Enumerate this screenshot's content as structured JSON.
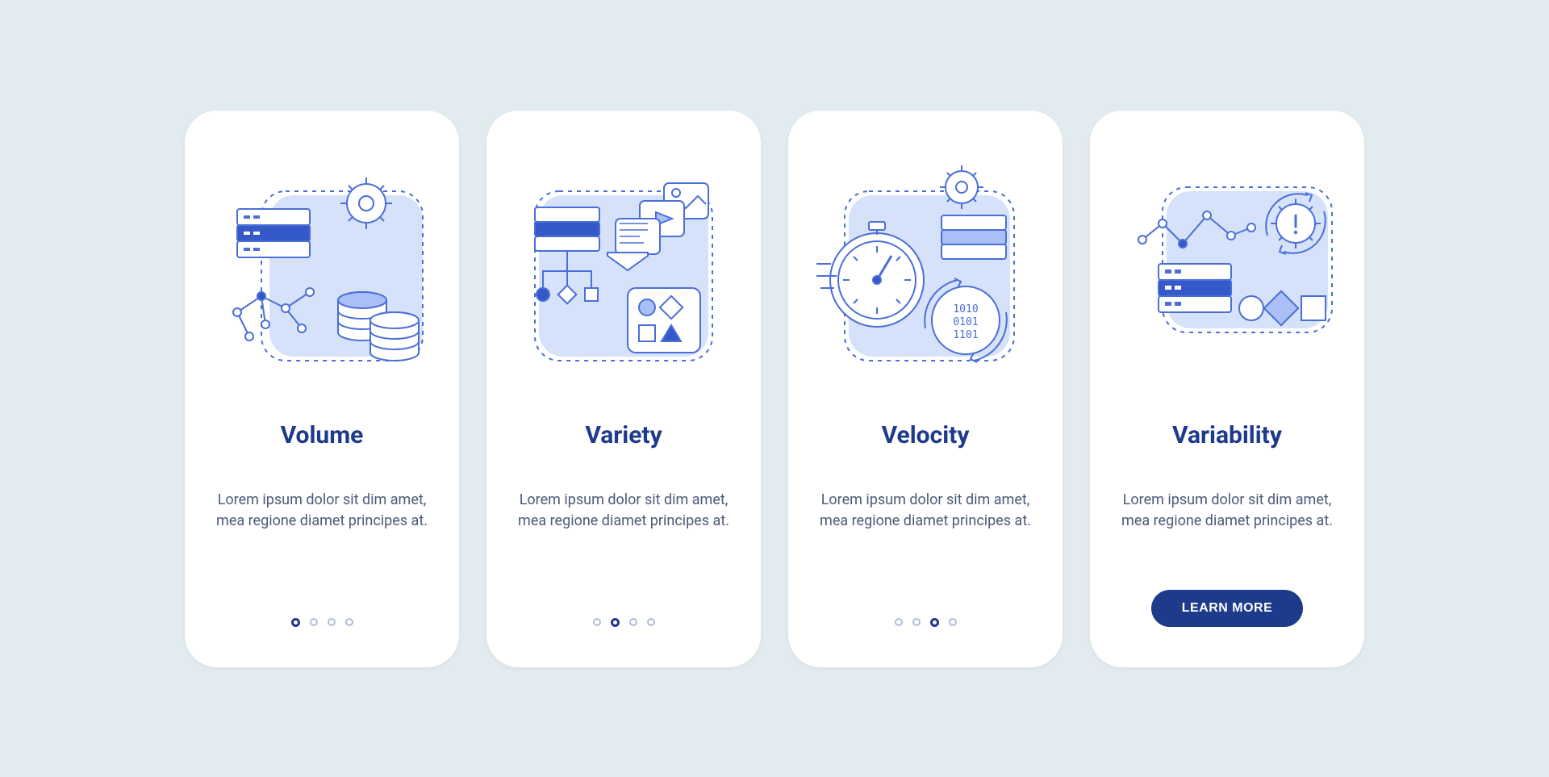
{
  "cards": [
    {
      "title": "Volume",
      "desc": "Lorem ipsum dolor sit dim amet, mea regione diamet principes at.",
      "activeDot": 0,
      "hasButton": false
    },
    {
      "title": "Variety",
      "desc": "Lorem ipsum dolor sit dim amet, mea regione diamet principes at.",
      "activeDot": 1,
      "hasButton": false
    },
    {
      "title": "Velocity",
      "desc": "Lorem ipsum dolor sit dim amet, mea regione diamet principes at.",
      "activeDot": 2,
      "hasButton": false
    },
    {
      "title": "Variability",
      "desc": "Lorem ipsum dolor sit dim amet, mea regione diamet principes at.",
      "activeDot": 3,
      "hasButton": true
    }
  ],
  "button_label": "LEARN MORE",
  "dot_count": 4,
  "colors": {
    "page_bg": "#E2ECF0",
    "card_bg": "#ffffff",
    "title": "#1E3A8A",
    "desc": "#4B5A7A",
    "accent": "#1E3A8A",
    "stroke": "#4A6FD6",
    "fill_light": "#D6E1FA",
    "fill_mid": "#A9BFF5"
  }
}
